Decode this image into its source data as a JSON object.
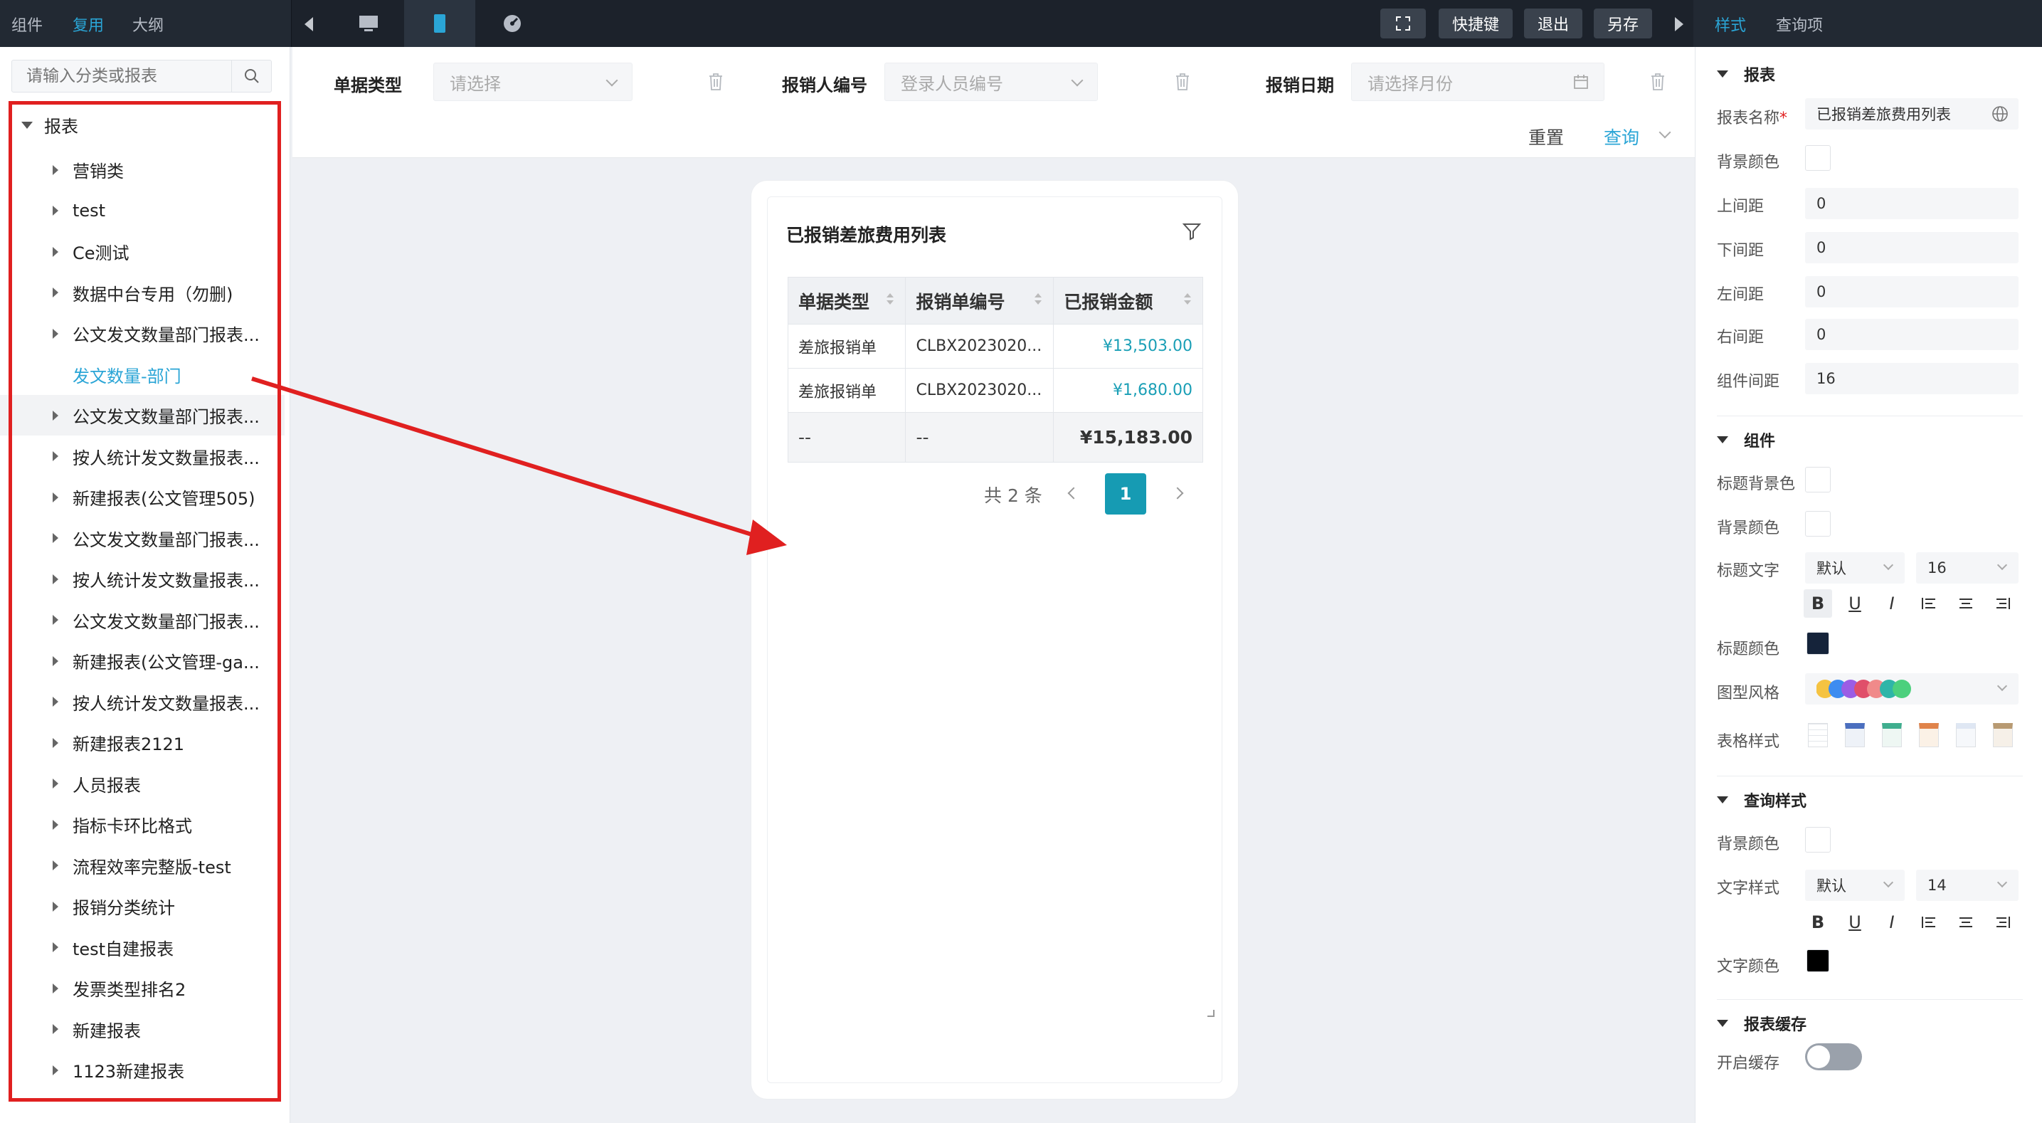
{
  "topbar": {
    "tabs": [
      "组件",
      "复用",
      "大纲"
    ],
    "active_tab": "复用",
    "buttons": {
      "shortcut": "快捷键",
      "exit": "退出",
      "save_as": "另存"
    },
    "right_tabs": [
      "样式",
      "查询项"
    ]
  },
  "sidebar": {
    "search_placeholder": "请输入分类或报表",
    "root": "报表",
    "items": [
      "营销类",
      "test",
      "Ce测试",
      "数据中台专用（勿删)",
      "公文发文数量部门报表...",
      "发文数量-部门",
      "公文发文数量部门报表...",
      "按人统计发文数量报表...",
      "新建报表(公文管理505)",
      "公文发文数量部门报表...",
      "按人统计发文数量报表...",
      "公文发文数量部门报表...",
      "新建报表(公文管理-ga...",
      "按人统计发文数量报表...",
      "新建报表2121",
      "人员报表",
      "指标卡环比格式",
      "流程效率完整版-test",
      "报销分类统计",
      "test自建报表",
      "发票类型排名2",
      "新建报表",
      "1123新建报表"
    ]
  },
  "query": {
    "f1_label": "单据类型",
    "f1_placeholder": "请选择",
    "f2_label": "报销人编号",
    "f2_placeholder": "登录人员编号",
    "f3_label": "报销日期",
    "f3_placeholder": "请选择月份",
    "reset": "重置",
    "search": "查询"
  },
  "card": {
    "title": "已报销差旅费用列表",
    "columns": [
      "单据类型",
      "报销单编号",
      "已报销金额"
    ],
    "rows": [
      [
        "差旅报销单",
        "CLBX2023020...",
        "¥13,503.00"
      ],
      [
        "差旅报销单",
        "CLBX2023020...",
        "¥1,680.00"
      ]
    ],
    "total": [
      "--",
      "--",
      "¥15,183.00"
    ],
    "pager_total": "共 2 条",
    "page": "1"
  },
  "panel": {
    "sec_report": "报表",
    "name_label": "报表名称",
    "name_required": "*",
    "name_value": "已报销差旅费用列表",
    "bg_label": "背景颜色",
    "top_label": "上间距",
    "top_value": "0",
    "bottom_label": "下间距",
    "bottom_value": "0",
    "left_label": "左间距",
    "left_value": "0",
    "right_label": "右间距",
    "right_value": "0",
    "gap_label": "组件间距",
    "gap_value": "16",
    "sec_component": "组件",
    "title_bg_label": "标题背景色",
    "comp_bg_label": "背景颜色",
    "title_text_label": "标题文字",
    "title_font": "默认",
    "title_size": "16",
    "title_color_label": "标题颜色",
    "chart_style_label": "图型风格",
    "table_style_label": "表格样式",
    "sec_query": "查询样式",
    "q_bg_label": "背景颜色",
    "q_text_label": "文字样式",
    "q_font": "默认",
    "q_size": "14",
    "q_color_label": "文字颜色",
    "sec_cache": "报表缓存",
    "cache_label": "开启缓存",
    "format_bold": "B",
    "format_underline": "U",
    "format_italic": "I"
  },
  "colors": {
    "accent": "#2aa5d6",
    "primary_page": "#169bb3",
    "topbar": "#222933",
    "annotation_red": "#e02020",
    "title_color_swatch": "#15233a",
    "text_color_swatch": "#000000",
    "palette": [
      "#f5c342",
      "#3d8cf0",
      "#9b5de5",
      "#e04f6a",
      "#f08a8a",
      "#2fb5a8",
      "#4cd07d"
    ]
  }
}
